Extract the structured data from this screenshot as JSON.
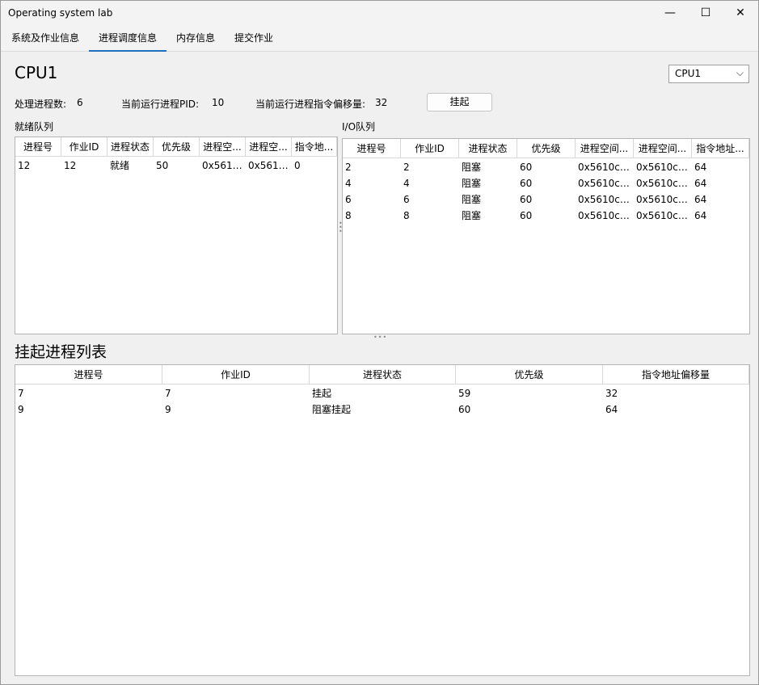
{
  "window": {
    "title": "Operating system lab",
    "min_glyph": "—",
    "max_glyph": "☐",
    "close_glyph": "✕"
  },
  "tabs": [
    {
      "label": "系统及作业信息"
    },
    {
      "label": "进程调度信息"
    },
    {
      "label": "内存信息"
    },
    {
      "label": "提交作业"
    }
  ],
  "active_tab": 1,
  "cpu": {
    "title": "CPU1",
    "selector_value": "CPU1",
    "chevron": "⌵",
    "processes_label": "处理进程数:",
    "processes_value": "6",
    "pid_label": "当前运行进程PID:",
    "pid_value": "10",
    "offset_label": "当前运行进程指令偏移量:",
    "offset_value": "32",
    "suspend_button": "挂起"
  },
  "ready_queue": {
    "label": "就绪队列",
    "columns": [
      "进程号",
      "作业ID",
      "进程状态",
      "优先级",
      "进程空...",
      "进程空...",
      "指令地..."
    ],
    "rows": [
      [
        "12",
        "12",
        "就绪",
        "50",
        "0x5610...",
        "0x5610...",
        "0"
      ]
    ]
  },
  "io_queue": {
    "label": "I/O队列",
    "columns": [
      "进程号",
      "作业ID",
      "进程状态",
      "优先级",
      "进程空间...",
      "进程空间...",
      "指令地址..."
    ],
    "rows": [
      [
        "2",
        "2",
        "阻塞",
        "60",
        "0x5610cb...",
        "0x5610cb...",
        "64"
      ],
      [
        "4",
        "4",
        "阻塞",
        "60",
        "0x5610cb...",
        "0x5610cb...",
        "64"
      ],
      [
        "6",
        "6",
        "阻塞",
        "60",
        "0x5610cb...",
        "0x5610cb...",
        "64"
      ],
      [
        "8",
        "8",
        "阻塞",
        "60",
        "0x5610cb...",
        "0x5610cb...",
        "64"
      ]
    ]
  },
  "suspended": {
    "label": "挂起进程列表",
    "columns": [
      "进程号",
      "作业ID",
      "进程状态",
      "优先级",
      "指令地址偏移量"
    ],
    "rows": [
      [
        "7",
        "7",
        "挂起",
        "59",
        "32"
      ],
      [
        "9",
        "9",
        "阻塞挂起",
        "60",
        "64"
      ]
    ]
  },
  "colors": {
    "accent": "#1f6fbf",
    "background": "#f0f0f0",
    "table_bg": "#ffffff"
  }
}
